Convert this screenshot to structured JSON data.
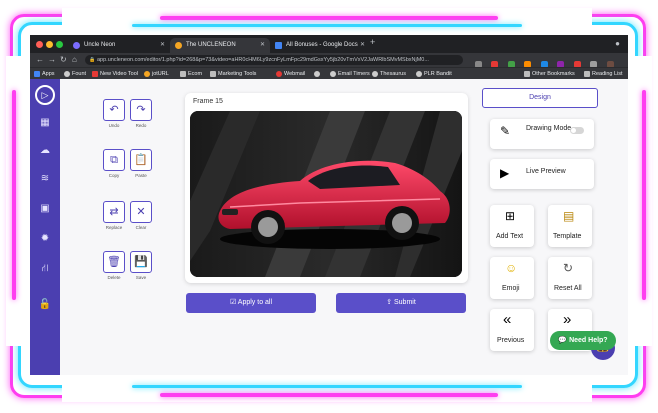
{
  "browser": {
    "tabs": [
      {
        "title": "Uncle Neon",
        "active": false
      },
      {
        "title": "The UNCLENEON",
        "active": true
      },
      {
        "title": "All Bonuses - Google Docs",
        "active": false
      }
    ],
    "url": "app.uncleneon.com/editor/1.php?id=268&p=73&video=aHR0cHM6Ly9zcnFyLmFpc29mdGsxYy5jb20vTmVxV2JaWRlbSMvMSbxNjM0...",
    "bookmarks": [
      "Apps",
      "Fount",
      "New Video Tool",
      "jotURL",
      "Ecom",
      "Marketing Tools",
      "Webmail",
      "",
      "Email Timers",
      "Thesaurus",
      "PLR Bandit"
    ],
    "bookmarks_right": [
      "Other Bookmarks",
      "Reading List"
    ]
  },
  "editor": {
    "tools": [
      {
        "label": "Undo",
        "icon": "undo-icon"
      },
      {
        "label": "Redo",
        "icon": "redo-icon"
      },
      {
        "label": "Copy",
        "icon": "copy-icon"
      },
      {
        "label": "Paste",
        "icon": "paste-icon"
      },
      {
        "label": "Replace",
        "icon": "replace-icon"
      },
      {
        "label": "Clear",
        "icon": "clear-icon"
      },
      {
        "label": "Delete",
        "icon": "trash-icon"
      },
      {
        "label": "Save",
        "icon": "save-icon"
      }
    ],
    "frame_title": "Frame 15",
    "apply_label": "Apply to all",
    "submit_label": "Submit"
  },
  "panel": {
    "design_label": "Design",
    "drawing_mode_label": "Drawing Mode",
    "live_preview_label": "Live Preview",
    "add_text_label": "Add Text",
    "template_label": "Template",
    "emoji_label": "Emoji",
    "reset_all_label": "Reset All",
    "previous_label": "Previous"
  },
  "help": {
    "label": "Need Help?"
  },
  "colors": {
    "brand": "#4b3fb0",
    "button": "#5a4fc9",
    "help": "#34a853",
    "neon_pink": "#ff3df0",
    "neon_blue": "#33d6ff"
  }
}
